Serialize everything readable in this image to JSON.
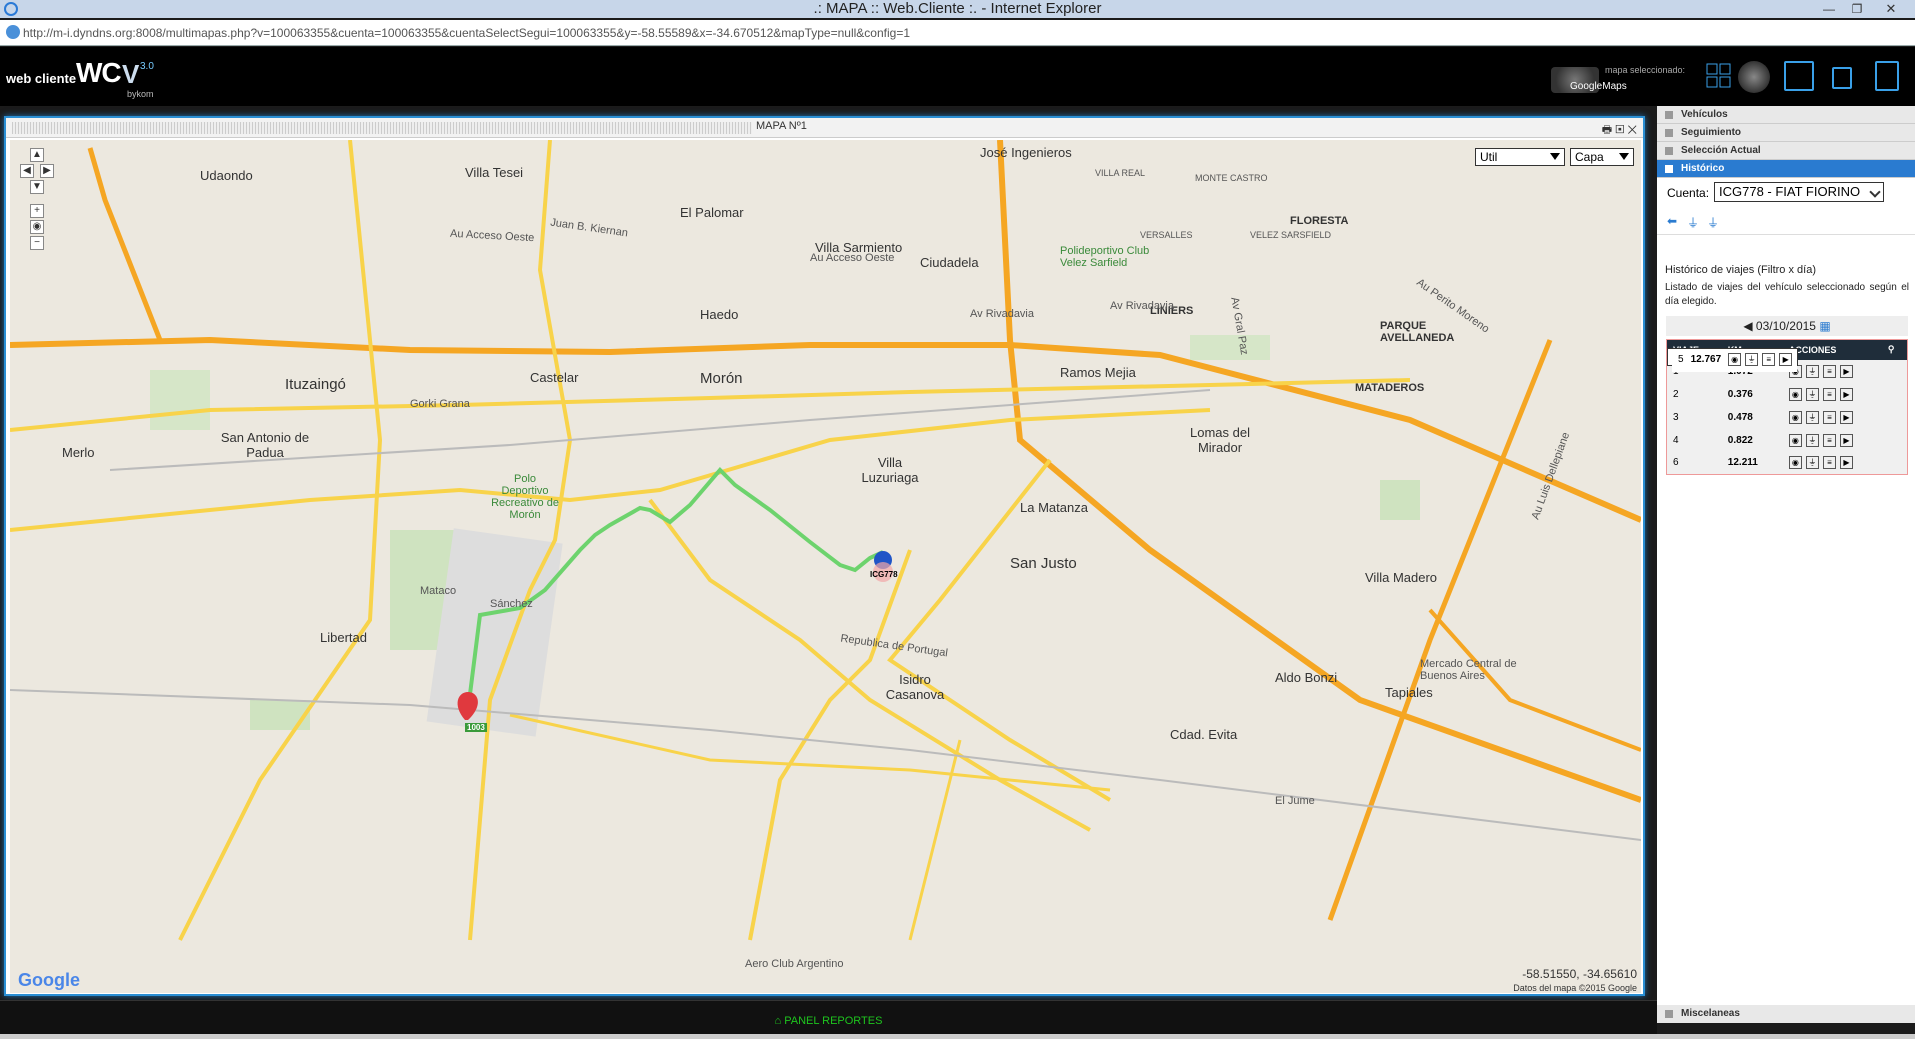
{
  "window": {
    "title": ".: MAPA :: Web.Cliente :. - Internet Explorer"
  },
  "address": {
    "url": "http://m-i.dyndns.org:8008/multimapas.php?v=100063355&cuenta=100063355&cuentaSelectSegui=100063355&y=-58.55589&x=-34.670512&mapType=null&config=1"
  },
  "brand": {
    "line1": "web cliente",
    "wc": "WC",
    "v": "V",
    "version": "3.0",
    "maker": "bykom"
  },
  "header": {
    "map_selected_label": "mapa seleccionado:",
    "map_selected_value": "GoogleMaps"
  },
  "map_window": {
    "title": "MAPA Nº1",
    "util_select": "Util",
    "capa_select": "Capa",
    "coords": "-58.51550, -34.65610",
    "copyright": "Datos del mapa ©2015 Google",
    "google": "Google",
    "vehicle_label": "ICG778",
    "start_label": "1003"
  },
  "map_labels": {
    "udaondo": "Udaondo",
    "villa_tesei": "Villa Tesei",
    "el_palomar": "El Palomar",
    "jose_ingenieros": "José Ingenieros",
    "villa_real": "VILLA REAL",
    "monte_castro": "MONTE CASTRO",
    "floresta": "FLORESTA",
    "velez_sarsfield": "VELEZ SARSFIELD",
    "versalles": "VERSALLES",
    "villa_sarmiento": "Villa Sarmiento",
    "ciudadela": "Ciudadela",
    "polideportivo": "Polideportivo Club Velez Sarfield",
    "haedo": "Haedo",
    "liniers": "LINIERS",
    "parque_avellaneda": "PARQUE AVELLANEDA",
    "ituzaingo": "Ituzaingó",
    "castelar": "Castelar",
    "moron": "Morón",
    "ramos_mejia": "Ramos Mejia",
    "mataderos": "MATADEROS",
    "gorki_grana": "Gorki Grana",
    "san_antonio": "San Antonio de Padua",
    "merlo": "Merlo",
    "lomas_del_mirador": "Lomas del Mirador",
    "villa_luzuriaga": "Villa Luzuriaga",
    "polo_deportivo": "Polo Deportivo Recreativo de Morón",
    "la_matanza": "La Matanza",
    "san_justo": "San Justo",
    "villa_madero": "Villa Madero",
    "libertad": "Libertad",
    "mercado_central": "Mercado Central de Buenos Aires",
    "tapiales": "Tapiales",
    "isidro_casanova": "Isidro Casanova",
    "aldo_bonzi": "Aldo Bonzi",
    "cdad_evita": "Cdad. Evita",
    "aero_club": "Aero Club Argentino",
    "acceso_oeste_1": "Au Acceso Oeste",
    "acceso_oeste_2": "Au Acceso Oeste",
    "av_rivadavia_1": "Av Rivadavia",
    "av_rivadavia_2": "Av Rivadavia",
    "av_gral_paz": "Av Gral Paz",
    "republica_portugal": "Republica de Portugal",
    "av_perito_moreno": "Au Perito Moreno",
    "au_luis_dellepiane": "Au Luis Dellepiane",
    "juan_b_kiernan": "Juan B. Kiernan",
    "sanchez": "Sánchez",
    "mataco": "Mataco",
    "el_jume": "El Jume"
  },
  "panel": {
    "sections": {
      "vehiculos": "Vehículos",
      "seguimiento": "Seguimiento",
      "seleccion_actual": "Selección Actual",
      "historico": "Histórico",
      "miscelaneas": "Miscelaneas"
    },
    "cuenta_label": "Cuenta:",
    "cuenta_value": "ICG778 - FIAT FIORINO",
    "hist_title": "Histórico de viajes (Filtro x día)",
    "hist_desc": "Listado de viajes del vehículo seleccionado según el día elegido.",
    "date": "03/10/2015",
    "table_headers": {
      "viaje": "VIAJE",
      "km": "KM.",
      "acciones": "ACCIONES"
    },
    "trips": [
      {
        "viaje": "1",
        "km": "1.072"
      },
      {
        "viaje": "2",
        "km": "0.376"
      },
      {
        "viaje": "3",
        "km": "0.478"
      },
      {
        "viaje": "4",
        "km": "0.822"
      },
      {
        "viaje": "5",
        "km": "12.767"
      },
      {
        "viaje": "6",
        "km": "12.211"
      }
    ]
  },
  "footer": {
    "label": "PANEL REPORTES"
  }
}
